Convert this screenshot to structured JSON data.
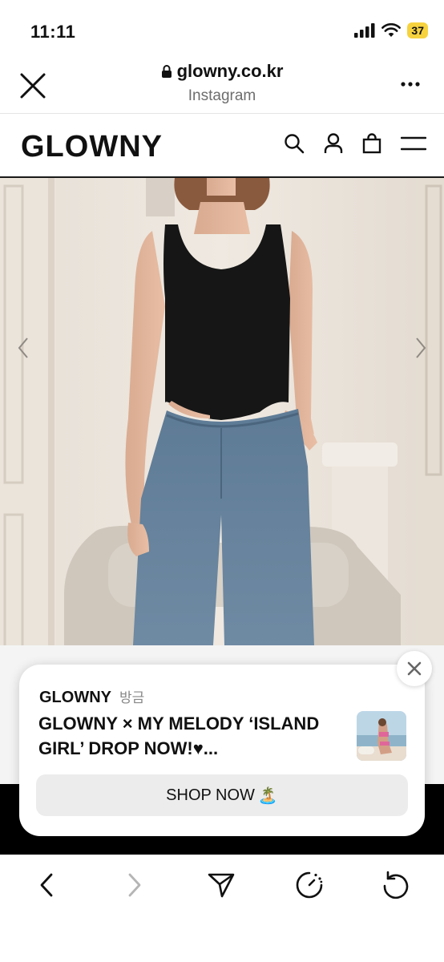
{
  "status_bar": {
    "time": "11:11",
    "battery": "37",
    "battery_color": "#f6d23f"
  },
  "browser": {
    "url": "glowny.co.kr",
    "subtitle": "Instagram",
    "icons": [
      "close-icon",
      "lock-icon",
      "more-icon"
    ]
  },
  "site": {
    "logo": "GLOWNY",
    "icons": [
      "search-icon",
      "user-icon",
      "bag-icon",
      "menu-icon"
    ]
  },
  "hero": {
    "arrows": [
      "chevron-left-icon",
      "chevron-right-icon"
    ]
  },
  "popup": {
    "brand": "GLOWNY",
    "time_ago": "방금",
    "title": "GLOWNY × MY MELODY ‘ISLAND GIRL’ DROP NOW!♥...",
    "cta_label": "SHOP NOW",
    "cta_emoji": "🏝️"
  },
  "toolbar": {
    "icons": [
      "back-icon",
      "forward-icon",
      "share-icon",
      "timer-icon",
      "reload-icon"
    ]
  },
  "colors": {
    "accent": "#111111",
    "cta_bg": "#ececec"
  }
}
